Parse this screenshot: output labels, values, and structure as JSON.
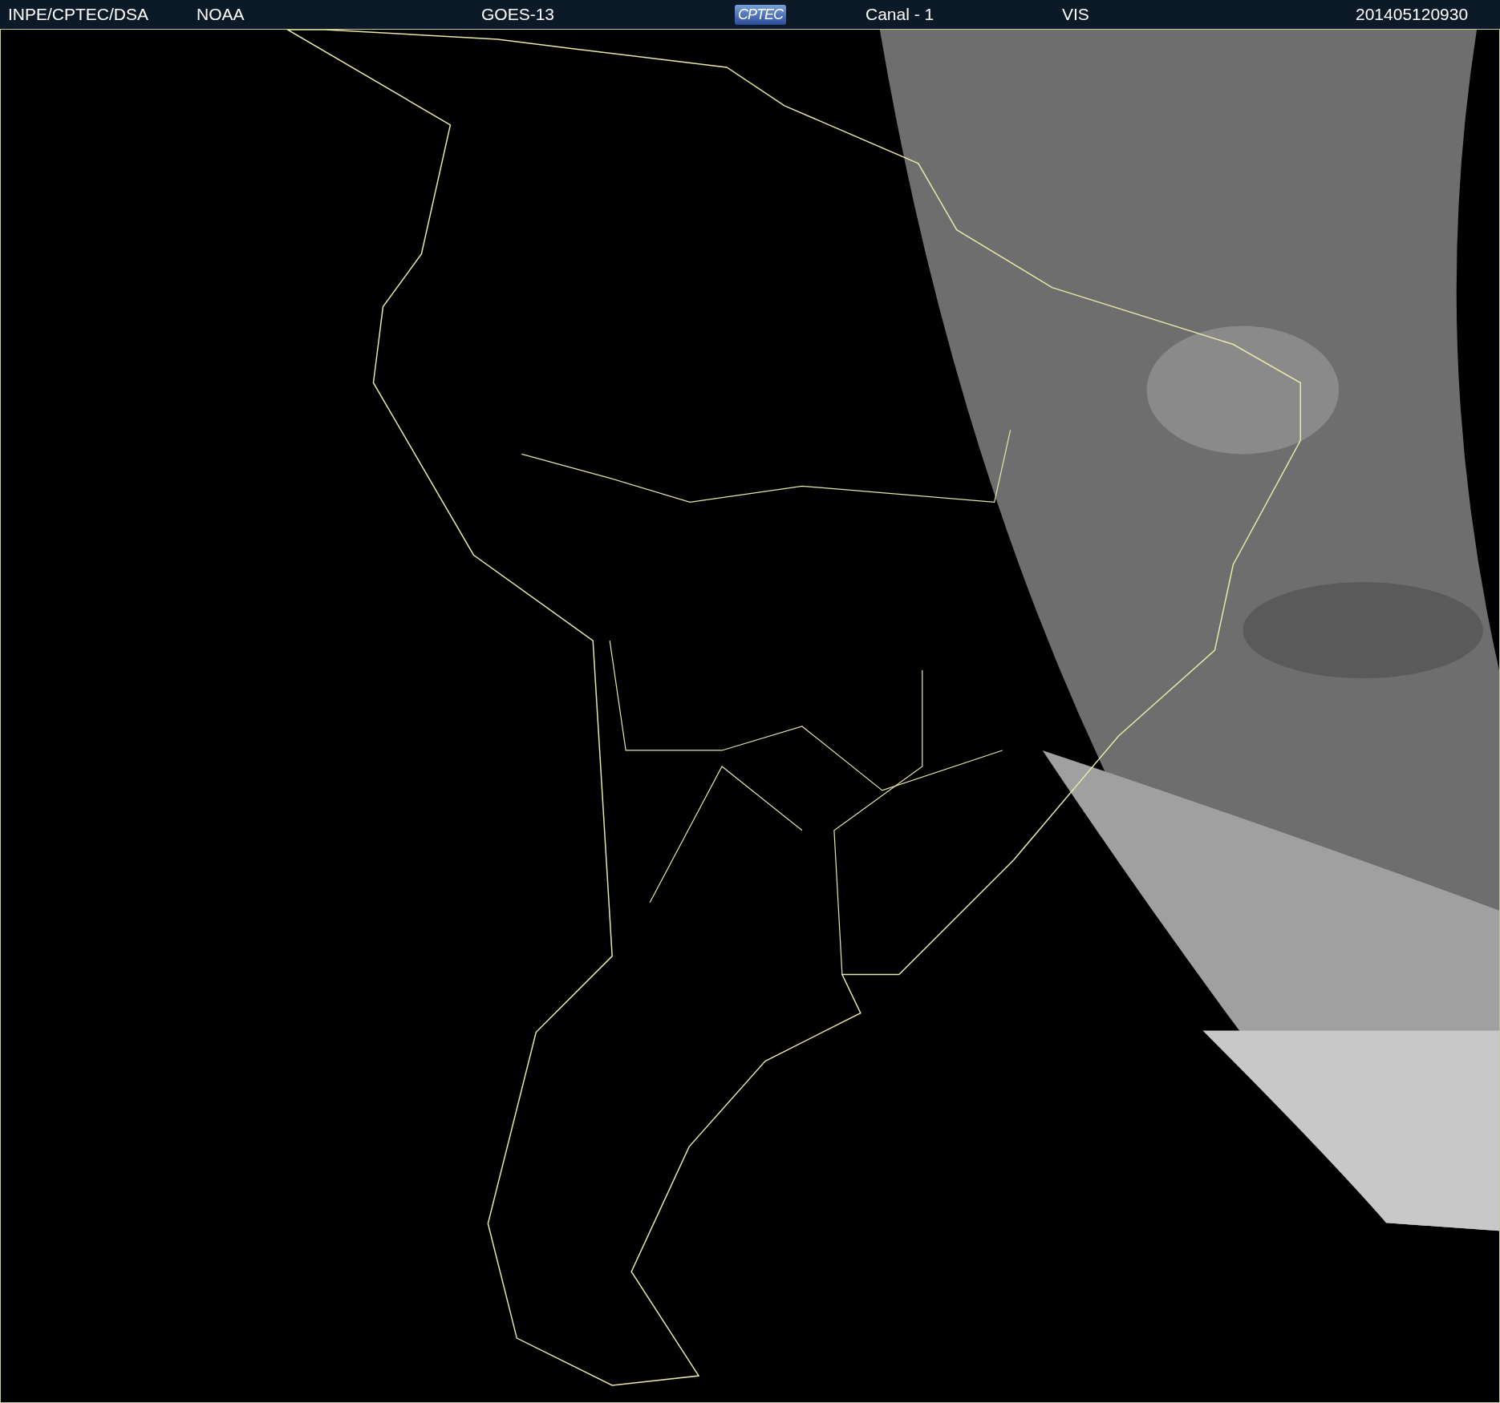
{
  "header": {
    "items": [
      {
        "kind": "text",
        "text": "INPE/CPTEC/DSA"
      },
      {
        "kind": "text",
        "text": "NOAA"
      },
      {
        "kind": "text",
        "text": "GOES-13"
      },
      {
        "kind": "logo",
        "text": "CPTEC"
      },
      {
        "kind": "text",
        "text": "Canal - 1"
      },
      {
        "kind": "text",
        "text": "VIS"
      },
      {
        "kind": "text",
        "text": "201405120930"
      }
    ]
  }
}
